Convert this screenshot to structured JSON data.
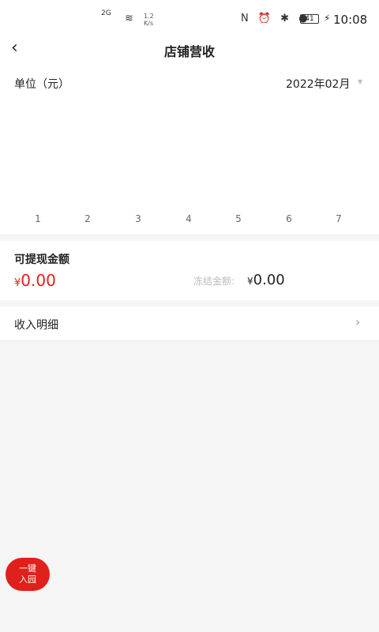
{
  "status": {
    "net": "2G",
    "speed_top": "1.2",
    "speed_bottom": "K/s",
    "icons": "N ⏰ ✱ ●",
    "battery": "41",
    "charge": "⚡",
    "time": "10:08"
  },
  "header": {
    "back_icon": "back-chevron-icon",
    "title": "店铺营收"
  },
  "chart": {
    "unit_label": "单位（元）",
    "month": "2022年02月",
    "x_ticks": [
      "1",
      "2",
      "3",
      "4",
      "5",
      "6",
      "7"
    ]
  },
  "chart_data": {
    "type": "bar",
    "categories": [
      "1",
      "2",
      "3",
      "4",
      "5",
      "6",
      "7"
    ],
    "values": [
      0,
      0,
      0,
      0,
      0,
      0,
      0
    ],
    "ylabel": "单位（元）"
  },
  "balance": {
    "title": "可提现金额",
    "currency": "¥",
    "amount": "0.00",
    "frozen_label": "冻结金额:",
    "frozen_currency": "¥",
    "frozen_amount": "0.00"
  },
  "income": {
    "label": "收入明细",
    "chevron": "›"
  },
  "fab": {
    "line1": "一键",
    "line2": "入园"
  }
}
